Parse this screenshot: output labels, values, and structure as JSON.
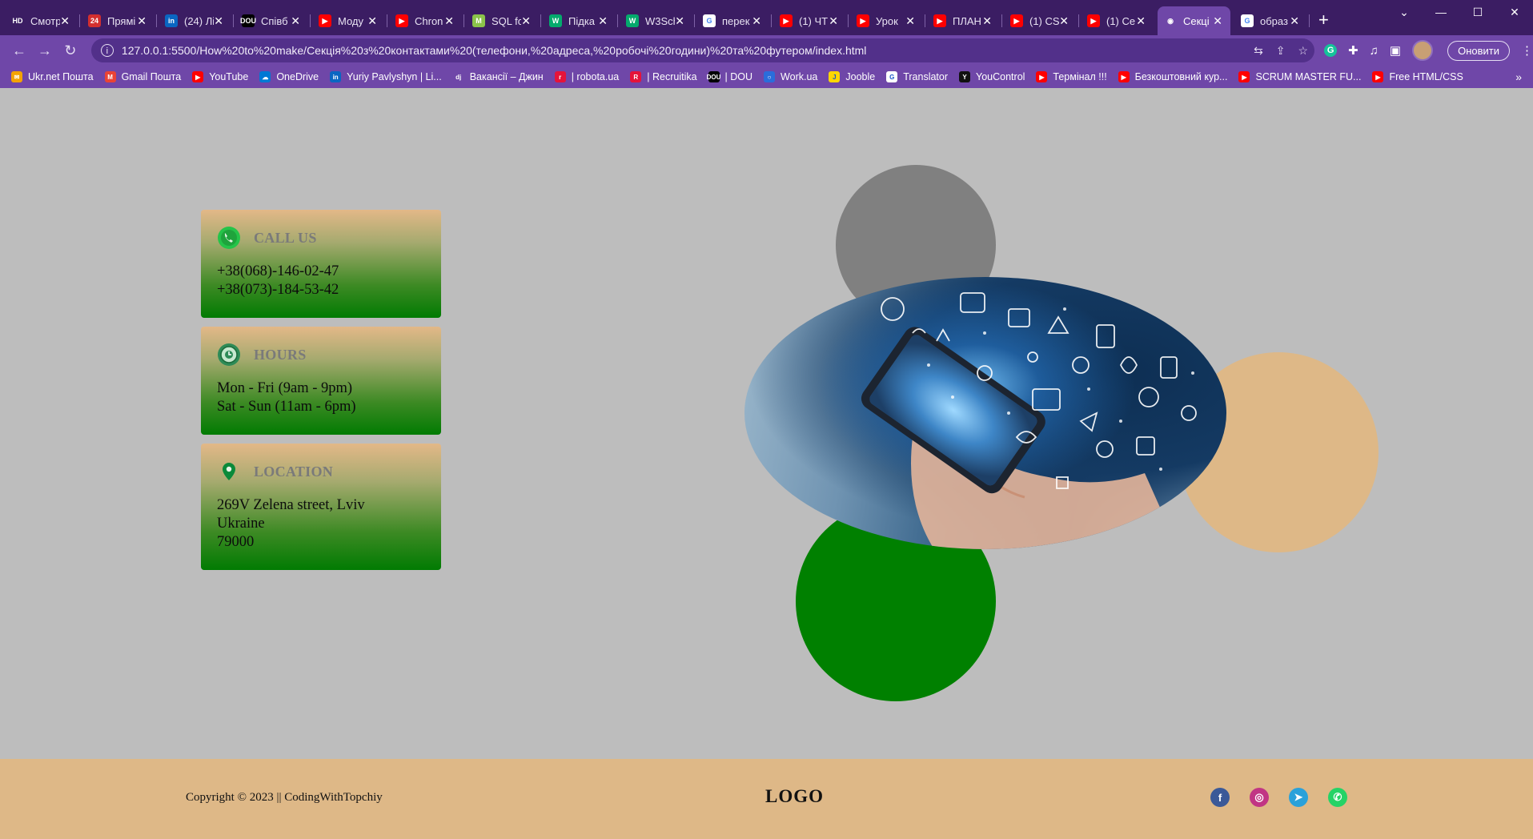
{
  "browser": {
    "tabs": [
      {
        "label": "Смотр",
        "icon": "hd-icon",
        "color": "#3b1d63",
        "glyph": "HD"
      },
      {
        "label": "Прямі",
        "icon": "24-icon",
        "color": "#d32f2f",
        "glyph": "24"
      },
      {
        "label": "(24) Лі",
        "icon": "linkedin-icon",
        "color": "#0a66c2",
        "glyph": "in"
      },
      {
        "label": "Співб",
        "icon": "dou-icon",
        "color": "#000000",
        "glyph": "DOU"
      },
      {
        "label": "Моду",
        "icon": "youtube-icon",
        "color": "#ff0000",
        "glyph": "▶"
      },
      {
        "label": "Chron",
        "icon": "youtube-icon",
        "color": "#ff0000",
        "glyph": "▶"
      },
      {
        "label": "SQL fo",
        "icon": "m-icon",
        "color": "#8bc34a",
        "glyph": "M"
      },
      {
        "label": "Підка",
        "icon": "w3schools-icon",
        "color": "#04aa6d",
        "glyph": "W"
      },
      {
        "label": "W3Sch",
        "icon": "w3schools-icon",
        "color": "#04aa6d",
        "glyph": "W"
      },
      {
        "label": "перек",
        "icon": "google-icon",
        "color": "#ffffff",
        "glyph": "G"
      },
      {
        "label": "(1) ЧТ",
        "icon": "youtube-icon",
        "color": "#ff0000",
        "glyph": "▶"
      },
      {
        "label": "Урок",
        "icon": "youtube-icon",
        "color": "#ff0000",
        "glyph": "▶"
      },
      {
        "label": "ПЛАН",
        "icon": "youtube-icon",
        "color": "#ff0000",
        "glyph": "▶"
      },
      {
        "label": "(1) CS",
        "icon": "youtube-icon",
        "color": "#ff0000",
        "glyph": "▶"
      },
      {
        "label": "(1) Се",
        "icon": "youtube-icon",
        "color": "#ff0000",
        "glyph": "▶"
      },
      {
        "label": "Секці",
        "icon": "globe-icon",
        "color": "#6f47a8",
        "glyph": "◉",
        "active": true
      },
      {
        "label": "образ",
        "icon": "google-icon",
        "color": "#ffffff",
        "glyph": "G"
      }
    ],
    "new_tab": "+",
    "window_controls": {
      "minimize": "—",
      "maximize": "☐",
      "close": "✕",
      "dropdown": "⌄"
    },
    "url": "127.0.0.1:5500/How%20to%20make/Секція%20з%20контактами%20(телефони,%20адреса,%20робочі%20години)%20та%20футером/index.html",
    "update_button": "Оновити",
    "bookmarks": [
      {
        "label": "Ukr.net Пошта",
        "color": "#f4a300",
        "glyph": "✉"
      },
      {
        "label": "Gmail Пошта",
        "color": "#ea4335",
        "glyph": "M"
      },
      {
        "label": "YouTube",
        "color": "#ff0000",
        "glyph": "▶"
      },
      {
        "label": "OneDrive",
        "color": "#0078d4",
        "glyph": "☁"
      },
      {
        "label": "Yuriy Pavlyshyn | Li...",
        "color": "#0a66c2",
        "glyph": "in"
      },
      {
        "label": "Вакансії – Джин",
        "color": "#6f47a8",
        "glyph": "dj"
      },
      {
        "label": "| robota.ua",
        "color": "#e5133a",
        "glyph": "r"
      },
      {
        "label": "| Recruitika",
        "color": "#e5133a",
        "glyph": "R"
      },
      {
        "label": "| DOU",
        "color": "#000000",
        "glyph": "DOU"
      },
      {
        "label": "Work.ua",
        "color": "#2a6ddb",
        "glyph": "○"
      },
      {
        "label": "Jooble",
        "color": "#ffd600",
        "glyph": "J"
      },
      {
        "label": "Translator",
        "color": "#ffffff",
        "glyph": "G"
      },
      {
        "label": "YouControl",
        "color": "#111111",
        "glyph": "Y"
      },
      {
        "label": "Термінал !!!",
        "color": "#ff0000",
        "glyph": "▶"
      },
      {
        "label": "Безкоштовний кур...",
        "color": "#ff0000",
        "glyph": "▶"
      },
      {
        "label": "SCRUM MASTER FU...",
        "color": "#ff0000",
        "glyph": "▶"
      },
      {
        "label": "Free HTML/CSS",
        "color": "#ff0000",
        "glyph": "▶"
      }
    ],
    "bookmarks_more": "»"
  },
  "contacts": {
    "call": {
      "title": "CALL US",
      "lines": [
        "+38(068)-146-02-47",
        "+38(073)-184-53-42"
      ]
    },
    "hours": {
      "title": "HOURS",
      "lines": [
        "Mon - Fri (9am - 9pm)",
        "Sat - Sun (11am - 6pm)"
      ]
    },
    "location": {
      "title": "LOCATION",
      "lines": [
        "269V Zelena street, Lviv",
        "Ukraine",
        "79000"
      ]
    }
  },
  "footer": {
    "copyright": "Copyright © 2023 || CodingWithTopchiy",
    "logo": "LOGO",
    "socials": [
      {
        "name": "facebook-icon",
        "color": "#3b5998",
        "glyph": "f"
      },
      {
        "name": "instagram-icon",
        "color": "#c13584",
        "glyph": "◎"
      },
      {
        "name": "telegram-icon",
        "color": "#2aa1da",
        "glyph": "➤"
      },
      {
        "name": "whatsapp-icon",
        "color": "#25d366",
        "glyph": "✆"
      }
    ]
  },
  "colors": {
    "page_bg": "#bdbdbd",
    "footer_bg": "#deb887",
    "circle_grey": "#808080",
    "circle_tan": "#deb887",
    "circle_green": "#008000"
  }
}
